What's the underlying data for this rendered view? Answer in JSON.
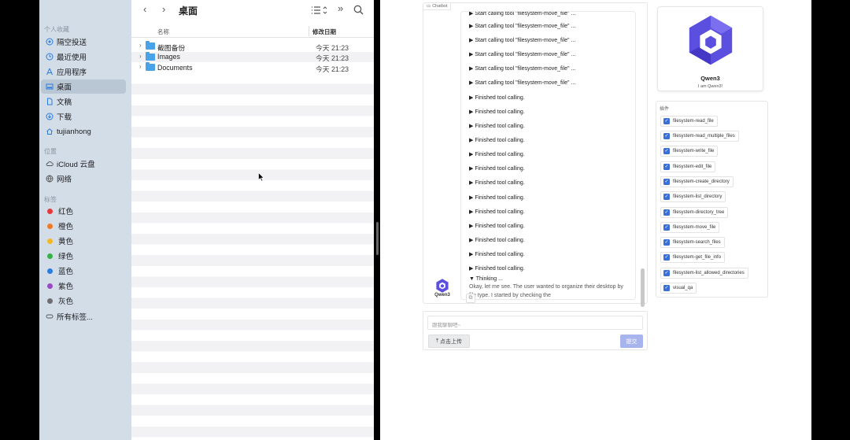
{
  "finder": {
    "sidebar": {
      "sections": [
        {
          "label": "个人收藏"
        },
        {
          "label": "位置"
        },
        {
          "label": "标签"
        }
      ],
      "favorites": [
        {
          "label": "隔空投送",
          "icon": "airdrop-icon"
        },
        {
          "label": "最近使用",
          "icon": "clock-icon"
        },
        {
          "label": "应用程序",
          "icon": "applications-icon"
        },
        {
          "label": "桌面",
          "icon": "desktop-icon",
          "active": true
        },
        {
          "label": "文稿",
          "icon": "document-icon"
        },
        {
          "label": "下载",
          "icon": "download-icon"
        },
        {
          "label": "tujianhong",
          "icon": "home-icon"
        }
      ],
      "locations": [
        {
          "label": "iCloud 云盘",
          "icon": "cloud-icon"
        },
        {
          "label": "网络",
          "icon": "network-icon"
        }
      ],
      "tags": [
        {
          "label": "红色",
          "color": "#e5383b"
        },
        {
          "label": "橙色",
          "color": "#f07b22"
        },
        {
          "label": "黄色",
          "color": "#f3b823"
        },
        {
          "label": "绿色",
          "color": "#33b249"
        },
        {
          "label": "蓝色",
          "color": "#2a7ce0"
        },
        {
          "label": "紫色",
          "color": "#9a49c4"
        },
        {
          "label": "灰色",
          "color": "#6e6e73"
        },
        {
          "label": "所有标签..."
        }
      ]
    },
    "toolbar": {
      "title": "桌面",
      "back": "‹",
      "forward": "›",
      "more": "»",
      "search_icon": "search-icon",
      "view_icon": "list-view-icon"
    },
    "columns": {
      "name": "名称",
      "date": "修改日期"
    },
    "files": [
      {
        "name": "截图备份",
        "date": "今天 21:23"
      },
      {
        "name": "Images",
        "date": "今天 21:23"
      },
      {
        "name": "Documents",
        "date": "今天 21:23"
      }
    ]
  },
  "chat": {
    "label": "Chatbot",
    "lines": [
      {
        "marker": "▶",
        "text": "Start calling tool \"filesystem-move_file\" ..."
      },
      {
        "marker": "▶",
        "text": "Start calling tool \"filesystem-move_file\" ..."
      },
      {
        "marker": "▶",
        "text": "Start calling tool \"filesystem-move_file\" ..."
      },
      {
        "marker": "▶",
        "text": "Start calling tool \"filesystem-move_file\" ..."
      },
      {
        "marker": "▶",
        "text": "Start calling tool \"filesystem-move_file\" ..."
      },
      {
        "marker": "▶",
        "text": "Start calling tool \"filesystem-move_file\" ..."
      },
      {
        "marker": "▶",
        "text": "Finished tool calling."
      },
      {
        "marker": "▶",
        "text": "Finished tool calling."
      },
      {
        "marker": "▶",
        "text": "Finished tool calling."
      },
      {
        "marker": "▶",
        "text": "Finished tool calling."
      },
      {
        "marker": "▶",
        "text": "Finished tool calling."
      },
      {
        "marker": "▶",
        "text": "Finished tool calling."
      },
      {
        "marker": "▶",
        "text": "Finished tool calling."
      },
      {
        "marker": "▶",
        "text": "Finished tool calling."
      },
      {
        "marker": "▶",
        "text": "Finished tool calling."
      },
      {
        "marker": "▶",
        "text": "Finished tool calling."
      },
      {
        "marker": "▶",
        "text": "Finished tool calling."
      },
      {
        "marker": "▶",
        "text": "Finished tool calling."
      },
      {
        "marker": "▶",
        "text": "Finished tool calling."
      }
    ],
    "thinking_label": "▼ Thinking ...",
    "thinking_text": "Okay, let me see. The user wanted to organize their desktop by file type. I started by checking the",
    "bot_name": "Qwen3",
    "input_placeholder": "跟我聊聊吧~",
    "upload_label": "点击上传",
    "submit_label": "提交"
  },
  "profile": {
    "name": "Qwen3",
    "description": "I am Qwen3!"
  },
  "plugins": {
    "title": "插件",
    "items": [
      {
        "label": "filesystem-read_file",
        "checked": true
      },
      {
        "label": "filesystem-read_multiple_files",
        "checked": true
      },
      {
        "label": "filesystem-write_file",
        "checked": true
      },
      {
        "label": "filesystem-edit_file",
        "checked": true
      },
      {
        "label": "filesystem-create_directory",
        "checked": true
      },
      {
        "label": "filesystem-list_directory",
        "checked": true
      },
      {
        "label": "filesystem-directory_tree",
        "checked": true
      },
      {
        "label": "filesystem-move_file",
        "checked": true
      },
      {
        "label": "filesystem-search_files",
        "checked": true
      },
      {
        "label": "filesystem-get_file_info",
        "checked": true
      },
      {
        "label": "filesystem-list_allowed_directories",
        "checked": true
      },
      {
        "label": "visual_qa",
        "checked": true
      }
    ]
  },
  "colors": {
    "accent": "#3b6fd8",
    "qwen_logo": "#5b4fe0",
    "submit": "#a8b4ee",
    "sidebar_bg": "#d3dde8"
  }
}
